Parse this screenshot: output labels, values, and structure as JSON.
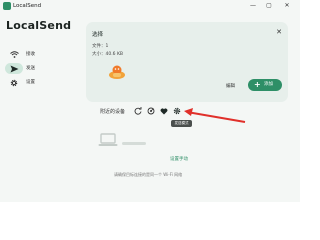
{
  "window": {
    "title": "LocalSend",
    "minimize_label": "—",
    "maximize_label": "▢",
    "close_label": "✕"
  },
  "app": {
    "name": "LocalSend"
  },
  "sidebar": {
    "items": [
      {
        "label": "接收",
        "icon": "wifi-icon",
        "active": false
      },
      {
        "label": "发送",
        "icon": "send-icon",
        "active": true
      },
      {
        "label": "设置",
        "icon": "gear-icon",
        "active": false
      }
    ]
  },
  "selection": {
    "title": "选择",
    "file_count": "文件：1",
    "file_size": "大小：40.6 KB",
    "close_icon": "✕",
    "edit_label": "编辑",
    "add_label": "添加",
    "add_icon": "+"
  },
  "nearby": {
    "title": "附近的设备",
    "tools": [
      "refresh-icon",
      "scan-icon",
      "favorite-icon",
      "settings-icon"
    ],
    "tooltip": "发送模式",
    "manual_label": "设置手动",
    "help_text": "请确保目标连接的是同一个 Wi-Fi 网络"
  },
  "colors": {
    "accent": "#2e8f67",
    "accent_light": "#cfe7dc",
    "annotation_arrow": "#e0302a"
  }
}
